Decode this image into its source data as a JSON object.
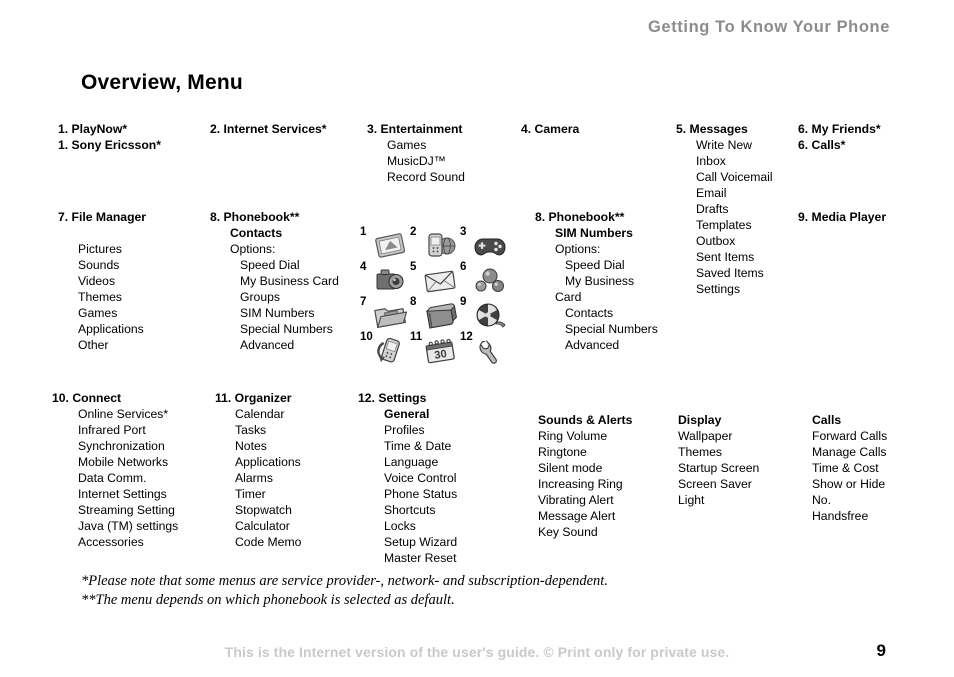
{
  "header": {
    "running_head": "Getting To Know Your Phone",
    "title": "Overview, Menu"
  },
  "columns": {
    "playnow": {
      "head1": "1. PlayNow*",
      "head2": "1. Sony Ericsson*"
    },
    "internet_services": {
      "head": "2. Internet Services*"
    },
    "entertainment": {
      "head": "3. Entertainment",
      "items": [
        "Games",
        "MusicDJ™",
        "Record Sound"
      ]
    },
    "camera": {
      "head": "4. Camera"
    },
    "messages": {
      "head": "5. Messages",
      "items": [
        "Write New",
        "Inbox",
        "Call Voicemail",
        "Email",
        "Drafts",
        "Templates",
        "Outbox",
        "Sent Items",
        "Saved Items",
        "Settings"
      ]
    },
    "my_friends": {
      "head1": "6. My Friends*",
      "head2": "6. Calls*"
    },
    "file_manager": {
      "head": "7. File Manager",
      "items": [
        "Pictures",
        "Sounds",
        "Videos",
        "Themes",
        "Games",
        "Applications",
        "Other"
      ]
    },
    "phonebook_contacts": {
      "head": "8. Phonebook**",
      "sub": "Contacts",
      "options_label": "Options:",
      "items": [
        "Speed Dial",
        "My Business Card",
        "Groups",
        "SIM Numbers",
        "Special Numbers",
        "Advanced"
      ]
    },
    "phonebook_sim": {
      "head": "8. Phonebook**",
      "sub": "SIM Numbers",
      "options_label": "Options:",
      "items": [
        "Speed Dial",
        "My Business"
      ],
      "wrapped": "Card",
      "items2": [
        "Contacts",
        "Special Numbers",
        "Advanced"
      ]
    },
    "media_player": {
      "head": "9. Media Player"
    },
    "connect": {
      "head": "10. Connect",
      "items": [
        "Online Services*",
        "Infrared Port",
        "Synchronization",
        "Mobile Networks",
        "Data Comm.",
        "Internet Settings",
        "Streaming Setting",
        "Java (TM) settings",
        "Accessories"
      ]
    },
    "organizer": {
      "head": "11. Organizer",
      "items": [
        "Calendar",
        "Tasks",
        "Notes",
        "Applications",
        "Alarms",
        "Timer",
        "Stopwatch",
        "Calculator",
        "Code Memo"
      ]
    },
    "settings": {
      "head": "12. Settings",
      "general": {
        "sub": "General",
        "items": [
          "Profiles",
          "Time & Date",
          "Language",
          "Voice Control",
          "Phone Status",
          "Shortcuts",
          "Locks",
          "Setup Wizard",
          "Master Reset"
        ]
      },
      "sounds": {
        "sub": "Sounds & Alerts",
        "items": [
          "Ring Volume",
          "Ringtone",
          "Silent mode",
          "Increasing Ring",
          "Vibrating Alert",
          "Message Alert",
          "Key Sound"
        ]
      },
      "display": {
        "sub": "Display",
        "items": [
          "Wallpaper",
          "Themes",
          "Startup Screen",
          "Screen Saver",
          "Light"
        ]
      },
      "calls": {
        "sub": "Calls",
        "items": [
          "Forward Calls",
          "Manage Calls",
          "Time & Cost",
          "Show or Hide",
          "No.",
          "Handsfree"
        ]
      }
    }
  },
  "icon_grid": [
    {
      "number": "1",
      "icon": "picture-icon"
    },
    {
      "number": "2",
      "icon": "internet-phone-icon"
    },
    {
      "number": "3",
      "icon": "gamepad-icon"
    },
    {
      "number": "4",
      "icon": "camera-icon"
    },
    {
      "number": "5",
      "icon": "envelope-icon"
    },
    {
      "number": "6",
      "icon": "friends-spheres-icon"
    },
    {
      "number": "7",
      "icon": "folder-icon"
    },
    {
      "number": "8",
      "icon": "phonebook-icon"
    },
    {
      "number": "9",
      "icon": "film-reel-icon"
    },
    {
      "number": "10",
      "icon": "connect-sync-icon"
    },
    {
      "number": "11",
      "icon": "calendar-icon"
    },
    {
      "number": "12",
      "icon": "wrench-icon"
    }
  ],
  "footnotes": {
    "line1": "*Please note that some menus are service provider-, network- and subscription-dependent.",
    "line2": "**The menu depends on which phonebook is selected as default."
  },
  "footer": {
    "note": "This is the Internet version of the user's guide. © Print only for private use.",
    "page_number": "9"
  },
  "colors": {
    "running_head": "#8c8c8c",
    "footer_note": "#c9c9c9",
    "text": "#000000"
  }
}
